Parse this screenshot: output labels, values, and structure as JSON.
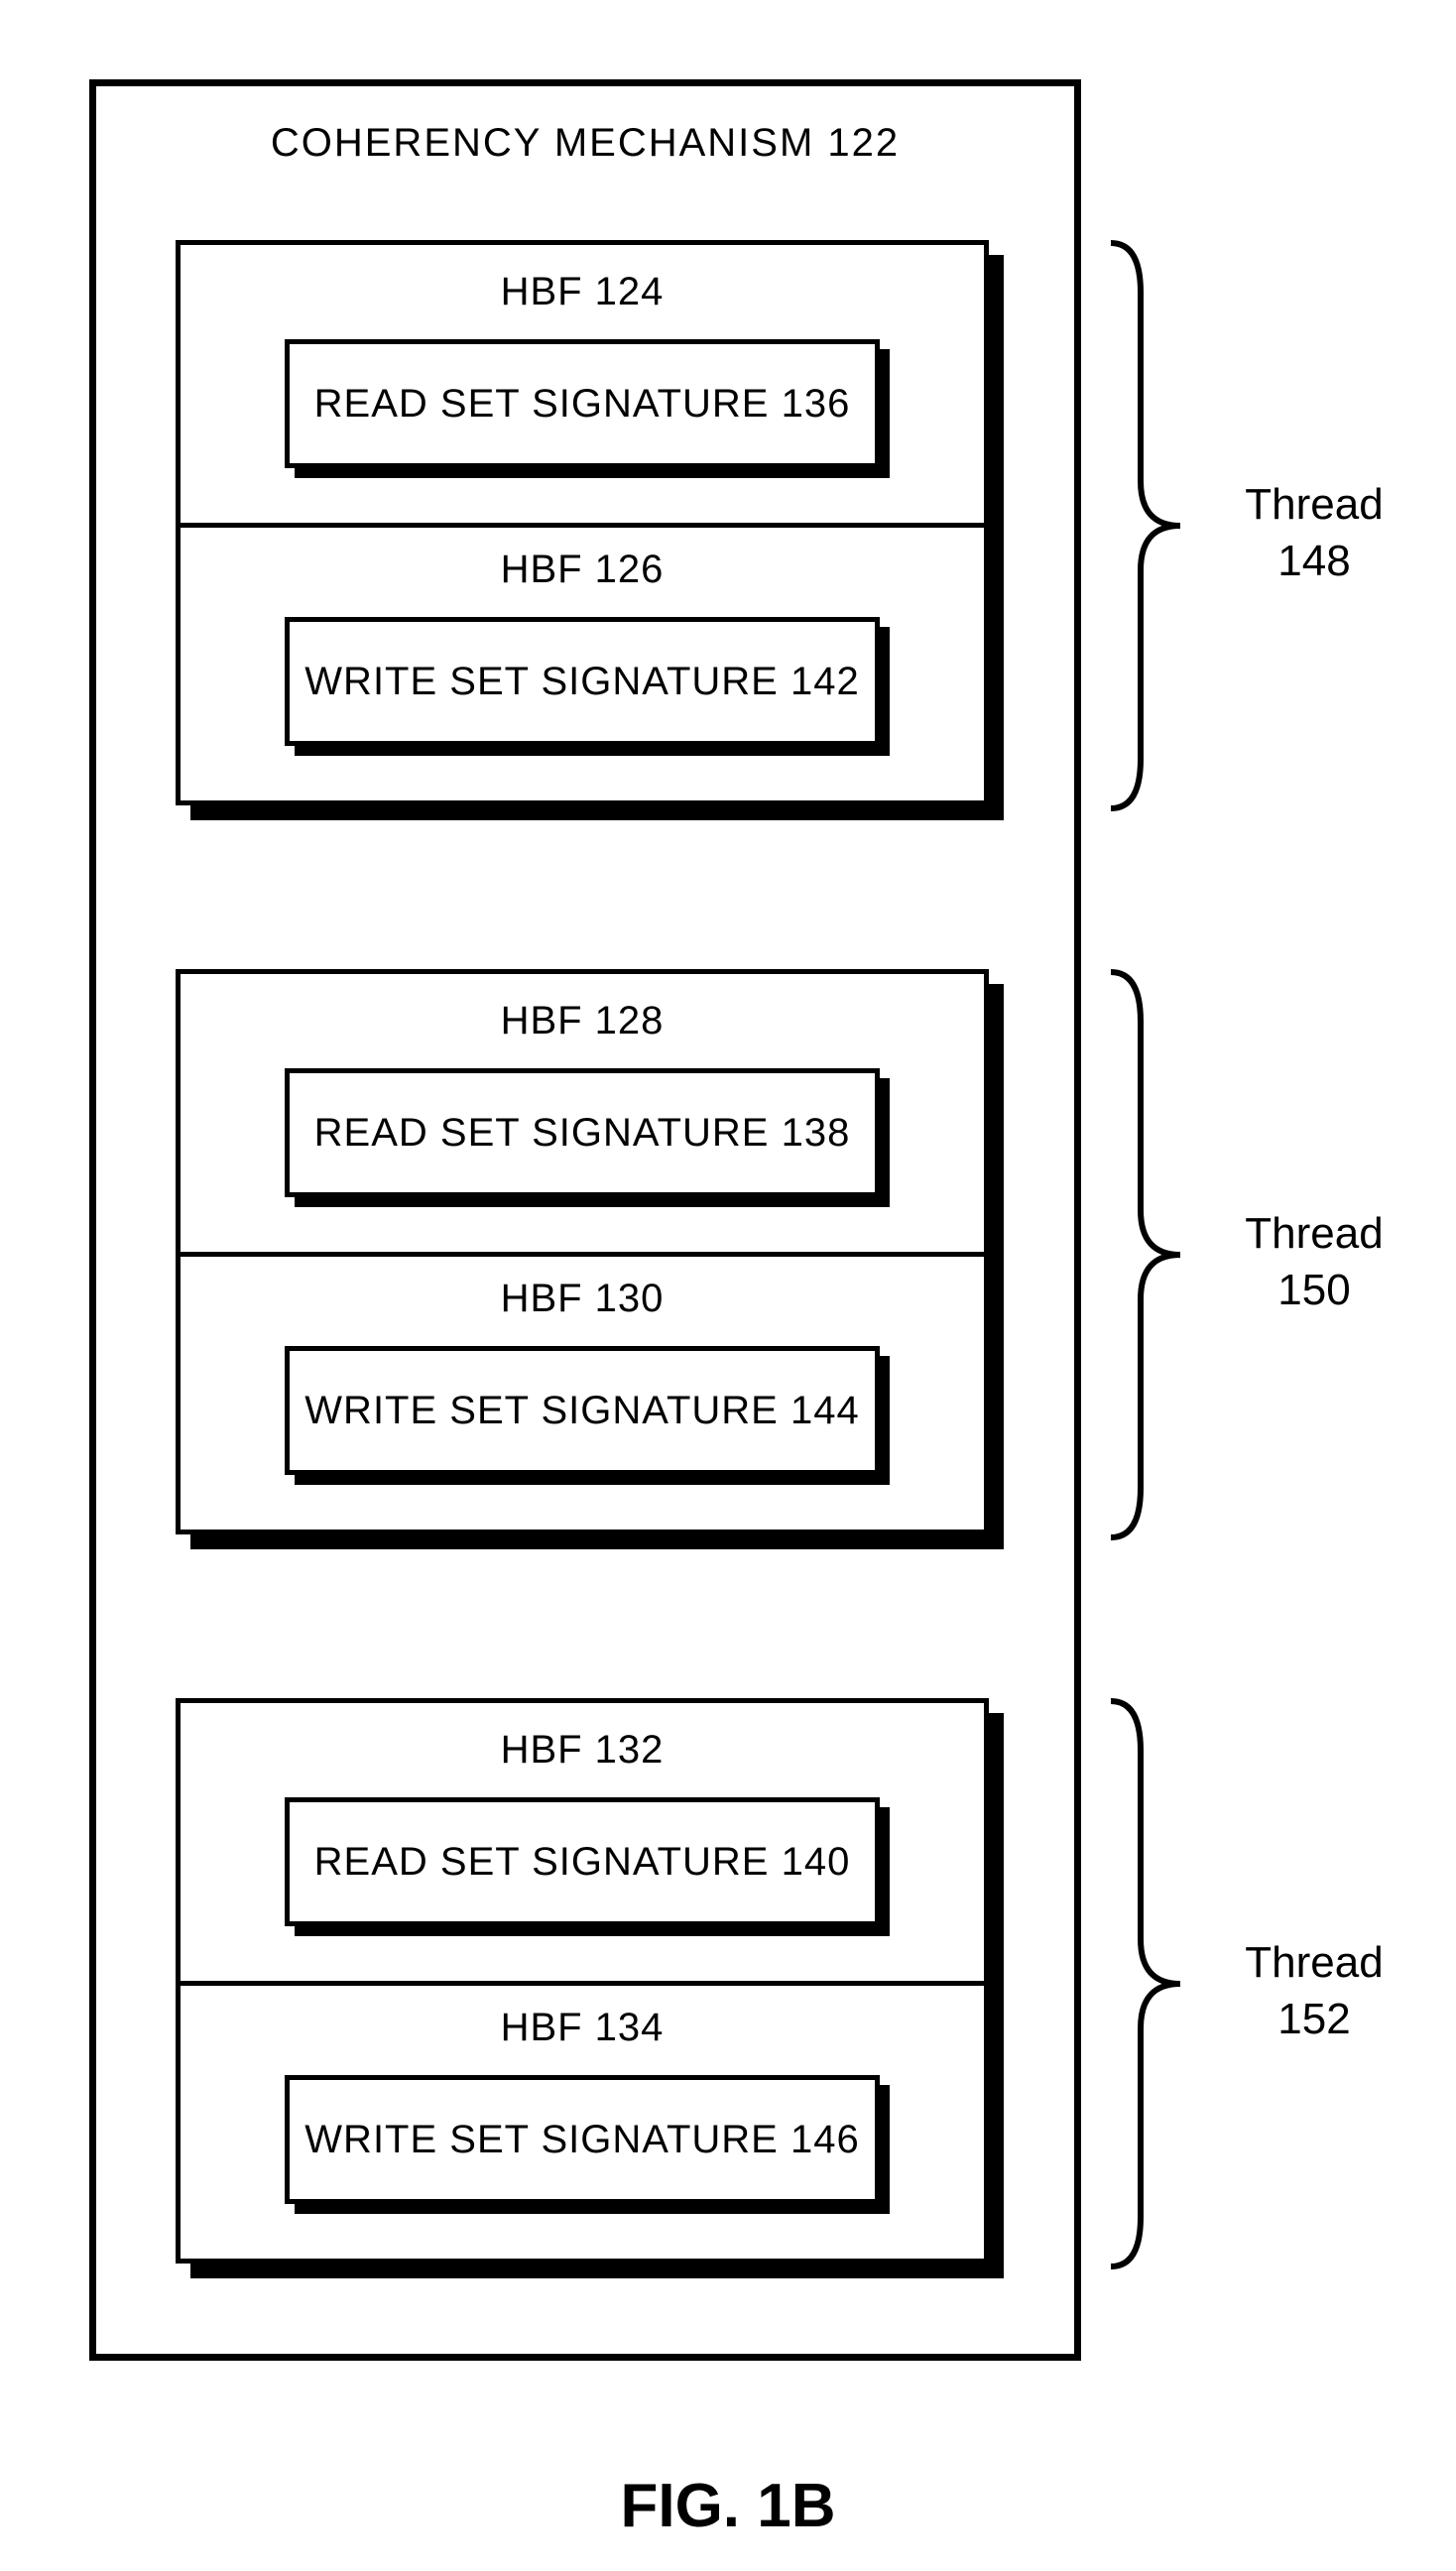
{
  "title": "COHERENCY MECHANISM 122",
  "groups": [
    {
      "hbf_top": "HBF 124",
      "inner_top": "READ SET SIGNATURE 136",
      "hbf_bottom": "HBF 126",
      "inner_bottom": "WRITE SET SIGNATURE 142",
      "thread": "Thread\n148"
    },
    {
      "hbf_top": "HBF 128",
      "inner_top": "READ SET SIGNATURE 138",
      "hbf_bottom": "HBF 130",
      "inner_bottom": "WRITE SET SIGNATURE 144",
      "thread": "Thread\n150"
    },
    {
      "hbf_top": "HBF 132",
      "inner_top": "READ SET SIGNATURE 140",
      "hbf_bottom": "HBF 134",
      "inner_bottom": "WRITE SET SIGNATURE 146",
      "thread": "Thread\n152"
    }
  ],
  "figure": "FIG. 1B"
}
